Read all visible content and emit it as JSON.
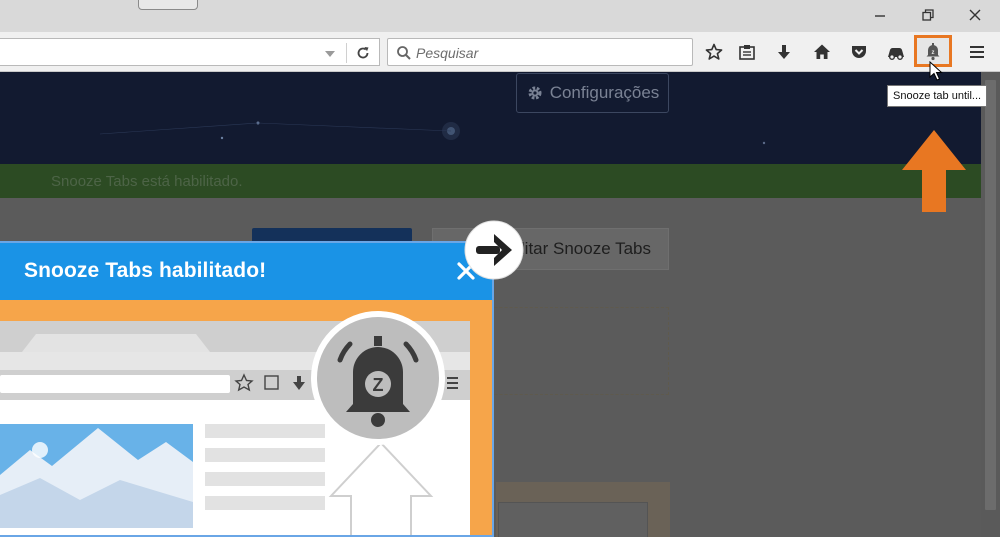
{
  "toolbar": {
    "search_placeholder": "Pesquisar",
    "tooltip": "Snooze tab until..."
  },
  "page": {
    "settings_label": "Configurações",
    "status_message": "Snooze Tabs está habilitado.",
    "disable_label": "bilitar Snooze Tabs"
  },
  "panel": {
    "title": "Snooze Tabs habilitado!",
    "bell_letter": "Z"
  },
  "colors": {
    "accent_orange": "#e87722",
    "panel_blue": "#1a93e6",
    "panel_orange": "#f6a54a"
  },
  "icons": [
    "minimize-icon",
    "restore-icon",
    "close-icon",
    "dropdown-arrow-icon",
    "reload-icon",
    "search-icon",
    "bookmark-star-icon",
    "reading-list-icon",
    "download-icon",
    "home-icon",
    "pocket-icon",
    "sync-icon",
    "snooze-bell-icon",
    "menu-icon",
    "gear-icon",
    "arrow-right-icon"
  ]
}
